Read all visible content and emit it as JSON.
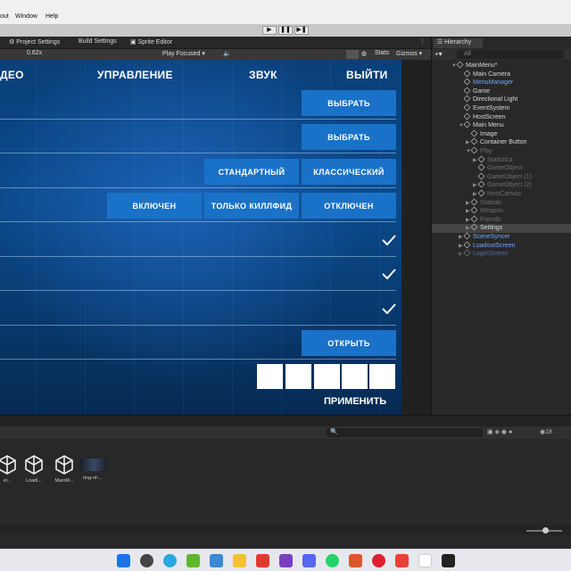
{
  "menubar": {
    "items": [
      "out",
      "Window",
      "Help"
    ]
  },
  "playbar": {
    "play": "▶",
    "pause": "❚❚",
    "step": "▶❚"
  },
  "tabs": {
    "project_settings": "Project Settings",
    "build_settings": "Build Settings",
    "sprite_editor": "Sprite Editor"
  },
  "game_toolbar": {
    "scale": "0.62x",
    "play_mode": "Play Focused",
    "stats": "Stats",
    "gizmos": "Gizmos"
  },
  "game": {
    "nav": [
      "ДЕО",
      "УПРАВЛЕНИЕ",
      "ЗВУК",
      "ВЫЙТИ"
    ],
    "buttons": {
      "select1": "ВЫБРАТЬ",
      "select2": "ВЫБРАТЬ",
      "standard": "СТАНДАРТНЫЙ",
      "classic": "КЛАССИЧЕСКИЙ",
      "enabled": "ВКЛЮЧЕН",
      "killfeed_only": "ТОЛЬКО КИЛЛФИД",
      "disabled": "ОТКЛЮЧЕН",
      "open": "ОТКРЫТЬ"
    },
    "checks": [
      "✓",
      "✓",
      "✓"
    ],
    "apply": "ПРИМЕНИТЬ"
  },
  "hierarchy": {
    "title": "Hierarchy",
    "search_placeholder": "All",
    "rows": [
      {
        "label": "MainMenu*",
        "depth": 0,
        "style": "normal",
        "arrow": "▼"
      },
      {
        "label": "Main Camera",
        "depth": 1,
        "style": "normal",
        "arrow": ""
      },
      {
        "label": "MenuManager",
        "depth": 1,
        "style": "blue",
        "arrow": ""
      },
      {
        "label": "Game",
        "depth": 1,
        "style": "normal",
        "arrow": ""
      },
      {
        "label": "Directional Light",
        "depth": 1,
        "style": "normal",
        "arrow": ""
      },
      {
        "label": "EventSystem",
        "depth": 1,
        "style": "normal",
        "arrow": ""
      },
      {
        "label": "HostScreen",
        "depth": 1,
        "style": "normal",
        "arrow": ""
      },
      {
        "label": "Main Menu",
        "depth": 1,
        "style": "normal",
        "arrow": "▼"
      },
      {
        "label": "Image",
        "depth": 2,
        "style": "normal",
        "arrow": ""
      },
      {
        "label": "Container Button",
        "depth": 2,
        "style": "normal",
        "arrow": "▶"
      },
      {
        "label": "Play",
        "depth": 2,
        "style": "dim",
        "arrow": "▼"
      },
      {
        "label": "Statistica",
        "depth": 3,
        "style": "dim",
        "arrow": "▶"
      },
      {
        "label": "GameObject",
        "depth": 3,
        "style": "dim",
        "arrow": ""
      },
      {
        "label": "GameObject (1)",
        "depth": 3,
        "style": "dim",
        "arrow": ""
      },
      {
        "label": "GameObject (2)",
        "depth": 3,
        "style": "dim",
        "arrow": "▶"
      },
      {
        "label": "HostCanvas",
        "depth": 3,
        "style": "dim",
        "arrow": "▶"
      },
      {
        "label": "Statistic",
        "depth": 2,
        "style": "dim",
        "arrow": "▶"
      },
      {
        "label": "Weapon",
        "depth": 2,
        "style": "dim",
        "arrow": "▶"
      },
      {
        "label": "Friends",
        "depth": 2,
        "style": "dim",
        "arrow": "▶"
      },
      {
        "label": "Settings",
        "depth": 2,
        "style": "sel",
        "arrow": "▶"
      },
      {
        "label": "SceneSyncer",
        "depth": 1,
        "style": "blue",
        "arrow": "▶"
      },
      {
        "label": "LoadoutScreen",
        "depth": 1,
        "style": "blue",
        "arrow": "▶"
      },
      {
        "label": "LoginScreen",
        "depth": 1,
        "style": "blue-dim",
        "arrow": "▶"
      }
    ]
  },
  "project": {
    "count": "18",
    "assets": [
      {
        "label": "el...",
        "kind": "unity"
      },
      {
        "label": "Loadi...",
        "kind": "unity"
      },
      {
        "label": "MainM...",
        "kind": "unity"
      },
      {
        "label": "ring-of-...",
        "kind": "image"
      }
    ]
  },
  "colors": {
    "button_blue": "#1a72c8",
    "game_bg": "#06305c",
    "hier_blue": "#6fa8ff"
  }
}
